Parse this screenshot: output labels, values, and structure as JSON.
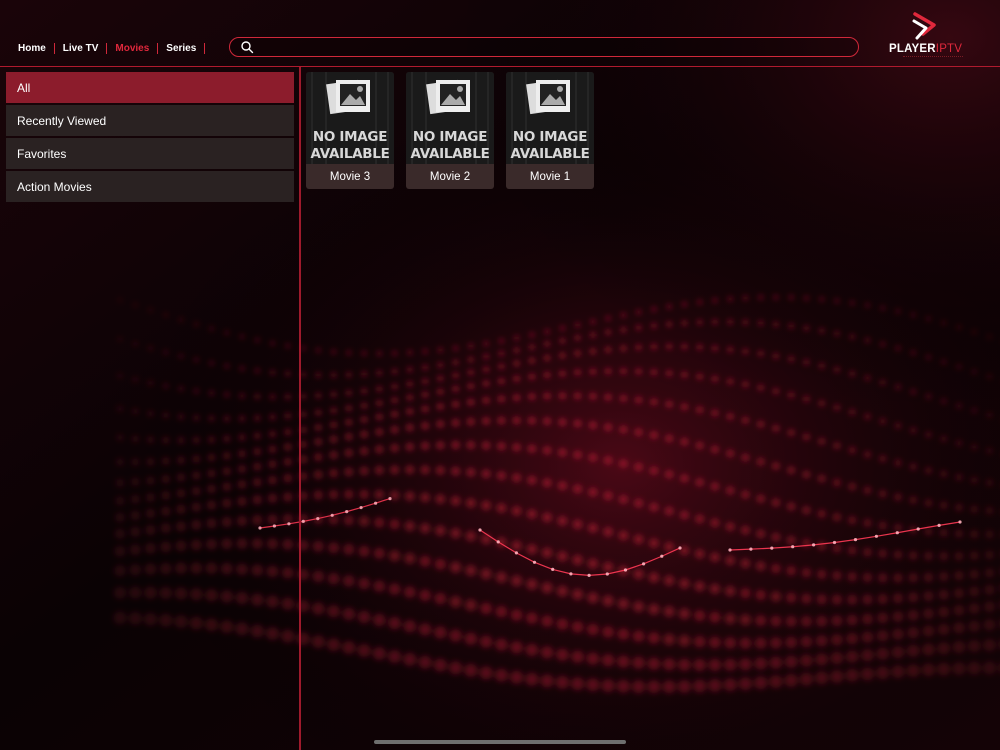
{
  "theme": {
    "accent": "#e0283c",
    "active_category_bg": "#8c1c2c",
    "item_bg": "#2a2222"
  },
  "nav": {
    "items": [
      {
        "label": "Home",
        "active": false
      },
      {
        "label": "Live TV",
        "active": false
      },
      {
        "label": "Movies",
        "active": true
      },
      {
        "label": "Series",
        "active": false
      }
    ]
  },
  "search": {
    "placeholder": "",
    "value": "",
    "icon": "search-icon"
  },
  "logo": {
    "brand_white": "PLAYER",
    "brand_red": "IPTV"
  },
  "categories": [
    {
      "label": "All",
      "active": true
    },
    {
      "label": "Recently Viewed",
      "active": false
    },
    {
      "label": "Favorites",
      "active": false
    },
    {
      "label": "Action Movies",
      "active": false
    }
  ],
  "movies": [
    {
      "title": "Movie 3",
      "poster_line1": "NO IMAGE",
      "poster_line2": "AVAILABLE"
    },
    {
      "title": "Movie 2",
      "poster_line1": "NO IMAGE",
      "poster_line2": "AVAILABLE"
    },
    {
      "title": "Movie 1",
      "poster_line1": "NO IMAGE",
      "poster_line2": "AVAILABLE"
    }
  ]
}
